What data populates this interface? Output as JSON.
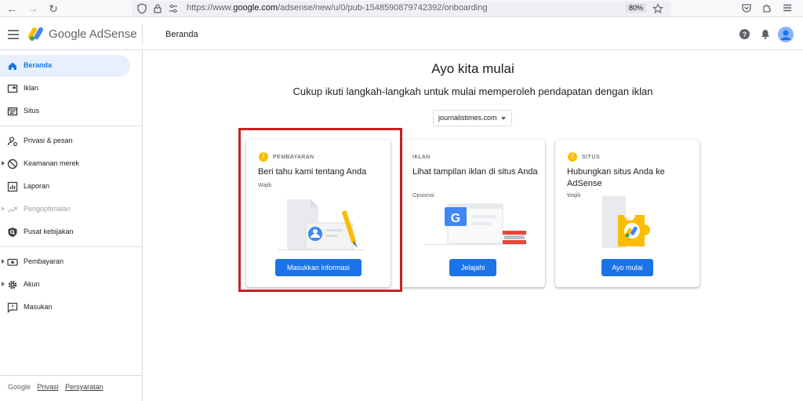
{
  "browser": {
    "url_prefix": "https://www.",
    "url_domain": "google.com",
    "url_path": "/adsense/new/u/0/pub-1548590879742392/onboarding",
    "zoom": "80%"
  },
  "header": {
    "brand": "Google AdSense",
    "title": "Beranda"
  },
  "sidebar": {
    "items": [
      {
        "label": "Beranda"
      },
      {
        "label": "Iklan"
      },
      {
        "label": "Situs"
      },
      {
        "label": "Privasi & pesan"
      },
      {
        "label": "Keamanan merek"
      },
      {
        "label": "Laporan"
      },
      {
        "label": "Pengoptimalan"
      },
      {
        "label": "Pusat kebijakan"
      },
      {
        "label": "Pembayaran"
      },
      {
        "label": "Akun"
      },
      {
        "label": "Masukan"
      }
    ],
    "footer": {
      "google": "Google",
      "privacy": "Privasi",
      "terms": "Persyaratan"
    }
  },
  "main": {
    "title": "Ayo kita mulai",
    "subtitle": "Cukup ikuti langkah-langkah untuk mulai memperoleh pendapatan dengan iklan",
    "site_select": "journalistimes.com",
    "cards": [
      {
        "kicker": "PEMBAYARAN",
        "title": "Beri tahu kami tentang Anda",
        "req": "Wajib",
        "button": "Masukkan informasi"
      },
      {
        "kicker": "IKLAN",
        "title": "Lihat tampilan iklan di situs Anda",
        "req": "Opsional",
        "button": "Jelajahi"
      },
      {
        "kicker": "SITUS",
        "title": "Hubungkan situs Anda ke AdSense",
        "req": "Wajib",
        "button": "Ayo mulai"
      }
    ]
  },
  "colors": {
    "accent": "#1a73e8",
    "active_bg": "#e8f0fe",
    "warning": "#fbbc04",
    "highlight": "#c5221f"
  }
}
